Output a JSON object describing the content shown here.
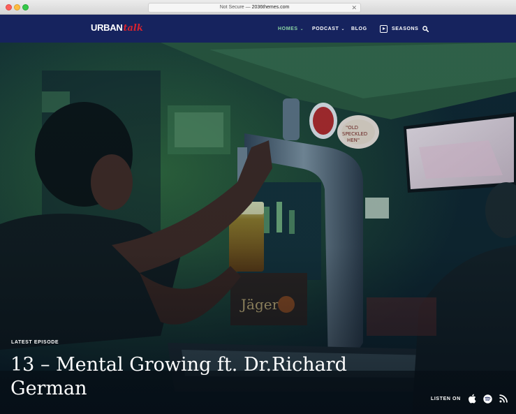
{
  "browser": {
    "url_prefix": "Not Secure —",
    "url_host": "2036themes.com"
  },
  "nav": {
    "logo_primary": "URBAN",
    "logo_secondary": "talk",
    "items": [
      {
        "label": "HOMES",
        "active": true
      },
      {
        "label": "PODCAST"
      },
      {
        "label": "BLOG"
      },
      {
        "label": "SEASONS"
      }
    ],
    "active_color": "#8cd6a5",
    "bar_color": "#16235e"
  },
  "hero": {
    "eyebrow": "LATEST EPISODE",
    "title": "13 – Mental Growing ft. Dr.Richard German",
    "listen_label": "LISTEN ON",
    "platforms": [
      "apple-icon",
      "spotify-icon",
      "rss-icon"
    ]
  }
}
